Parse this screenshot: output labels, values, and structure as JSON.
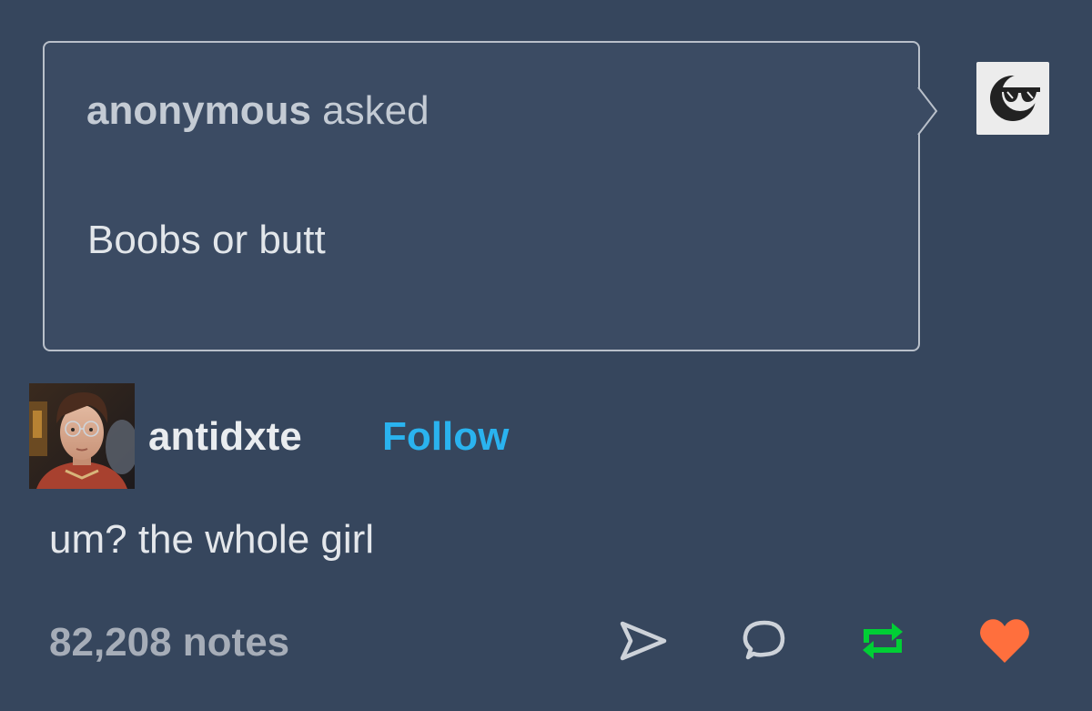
{
  "ask": {
    "asker": "anonymous",
    "verb": "asked",
    "question": "Boobs or butt"
  },
  "anon_avatar": {
    "icon": "sunglasses-face-icon"
  },
  "post": {
    "username": "antidxte",
    "follow_label": "Follow",
    "answer": "um? the whole girl",
    "notes": "82,208 notes"
  },
  "actions": {
    "share": "paper-plane-icon",
    "reply": "speech-bubble-icon",
    "reblog": "reblog-icon",
    "like": "heart-icon"
  },
  "colors": {
    "background": "#36465d",
    "follow": "#2ab3ef",
    "reblog": "#00cf35",
    "like": "#ff6f3d"
  }
}
